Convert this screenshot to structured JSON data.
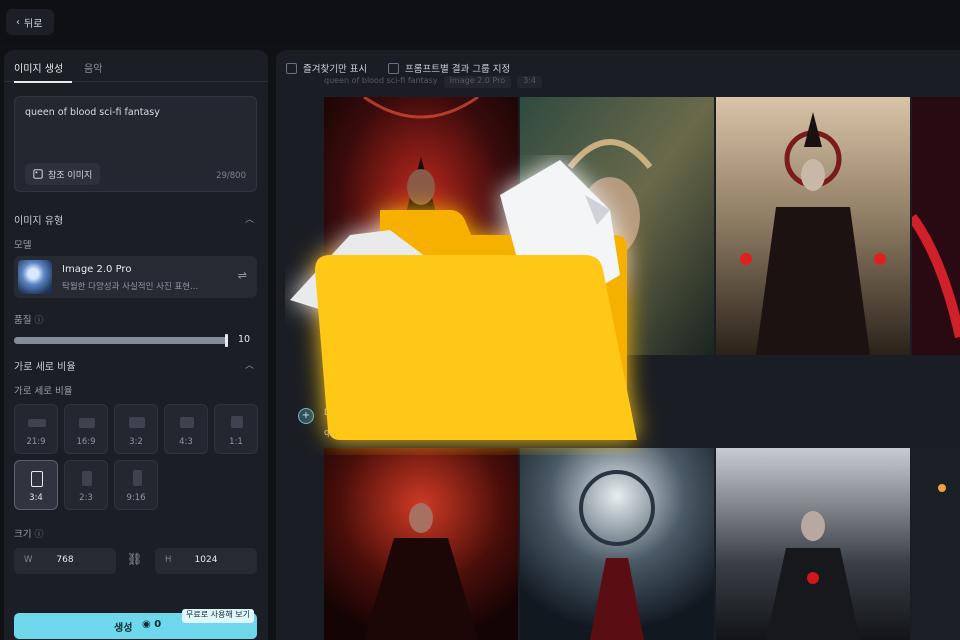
{
  "header": {
    "back_label": "뒤로"
  },
  "left_panel": {
    "tabs": [
      {
        "label": "이미지 생성"
      },
      {
        "label": "음악"
      }
    ],
    "prompt": {
      "value": "queen of blood sci-fi fantasy",
      "ref_button": "참조 이미지",
      "char_count": "29/800"
    },
    "image_type": {
      "title": "이미지 유형",
      "model_label": "모델"
    },
    "model": {
      "name": "Image 2.0 Pro",
      "description": "탁월한 다양성과 사실적인 사진 표현..."
    },
    "quality": {
      "label": "품질",
      "value": "10",
      "fraction": 1.0
    },
    "aspect": {
      "title": "가로 세로 비율",
      "sub_label": "가로 세로 비율",
      "options": [
        {
          "label": "21:9"
        },
        {
          "label": "16:9"
        },
        {
          "label": "3:2"
        },
        {
          "label": "4:3"
        },
        {
          "label": "1:1"
        },
        {
          "label": "3:4",
          "selected": true
        },
        {
          "label": "2:3"
        },
        {
          "label": "9:16"
        }
      ]
    },
    "size": {
      "label": "크기",
      "w_prefix": "W",
      "w_value": "768",
      "h_prefix": "H",
      "h_value": "1024"
    },
    "generate": {
      "label": "생성",
      "credit": "0",
      "badge": "무료로 사용해 보기"
    }
  },
  "results": {
    "favorites_only": "즐겨찾기만 표시",
    "group_by_prompt": "프롬프트별 결과 그룹 지정",
    "row1_meta": [
      "queen of blood sci-fi fantasy",
      "Image 2.0 Pro",
      "3:4"
    ],
    "row2_label": "Dre",
    "row2_sub": "que"
  },
  "colors": {
    "accent": "#6fd7eb",
    "folder_back": "#f7b500",
    "folder_front": "#ffc81a"
  }
}
